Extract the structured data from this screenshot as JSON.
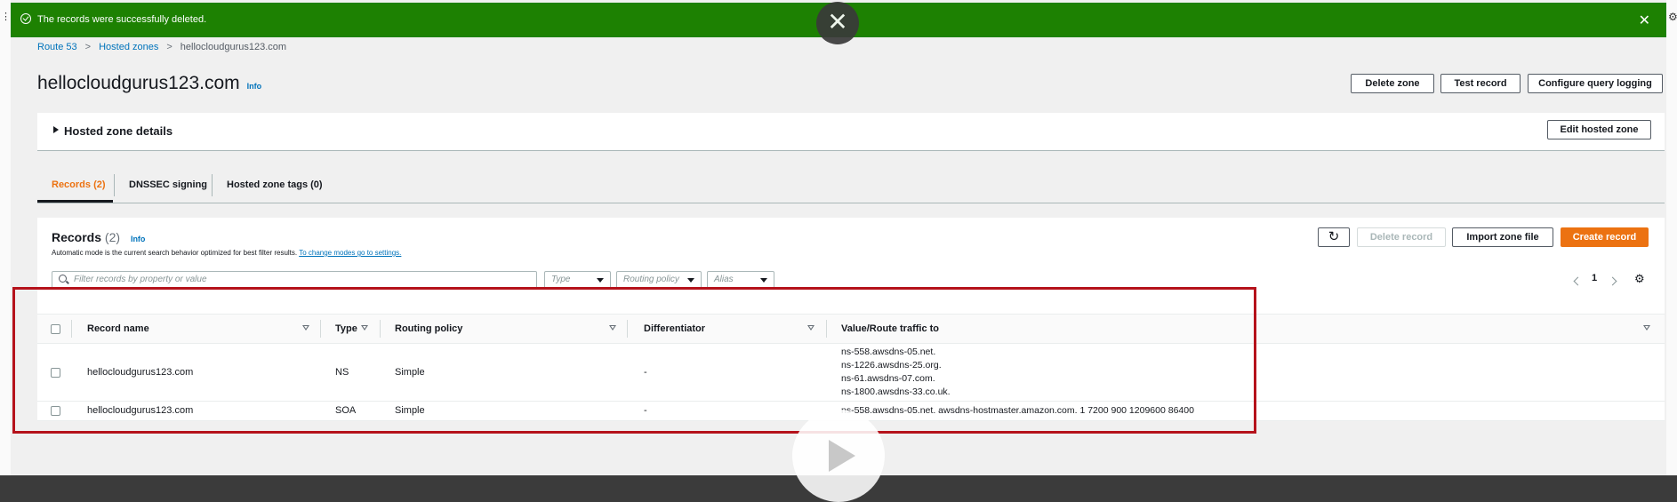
{
  "flash": {
    "message": "The records were successfully deleted.",
    "close_icon": "close-icon"
  },
  "overlay": {
    "close_glyph": "✕"
  },
  "breadcrumb": {
    "items": [
      "Route 53",
      "Hosted zones",
      "hellocloudgurus123.com"
    ]
  },
  "page": {
    "title": "hellocloudgurus123.com",
    "info": "Info"
  },
  "header_buttons": {
    "delete_zone": "Delete zone",
    "test_record": "Test record",
    "configure_logging": "Configure query logging"
  },
  "details_panel": {
    "label": "Hosted zone details",
    "edit_button": "Edit hosted zone"
  },
  "tabs": [
    "Records (2)",
    "DNSSEC signing",
    "Hosted zone tags (0)"
  ],
  "records": {
    "title": "Records",
    "count": "(2)",
    "info": "Info",
    "subtitle": "Automatic mode is the current search behavior optimized for best filter results.",
    "subtitle_link": "To change modes go to settings.",
    "refresh_glyph": "↻",
    "delete_record": "Delete record",
    "import_zone_file": "Import zone file",
    "create_record": "Create record",
    "search_placeholder": "Filter records by property or value",
    "filters": {
      "type": "Type",
      "routing_policy": "Routing policy",
      "alias": "Alias"
    },
    "page_number": "1",
    "columns": [
      "Record name",
      "Type",
      "Routing policy",
      "Differentiator",
      "Value/Route traffic to"
    ],
    "rows": [
      {
        "name": "hellocloudgurus123.com",
        "type": "NS",
        "routing": "Simple",
        "diff": "-",
        "values": [
          "ns-558.awsdns-05.net.",
          "ns-1226.awsdns-25.org.",
          "ns-61.awsdns-07.com.",
          "ns-1800.awsdns-33.co.uk."
        ]
      },
      {
        "name": "hellocloudgurus123.com",
        "type": "SOA",
        "routing": "Simple",
        "diff": "-",
        "values": [
          "ns-558.awsdns-05.net. awsdns-hostmaster.amazon.com. 1 7200 900 1209600 86400"
        ]
      }
    ]
  },
  "colors": {
    "success": "#1d8102",
    "accent": "#ec7211",
    "link": "#0073bb",
    "highlight_box": "#b5121b"
  }
}
